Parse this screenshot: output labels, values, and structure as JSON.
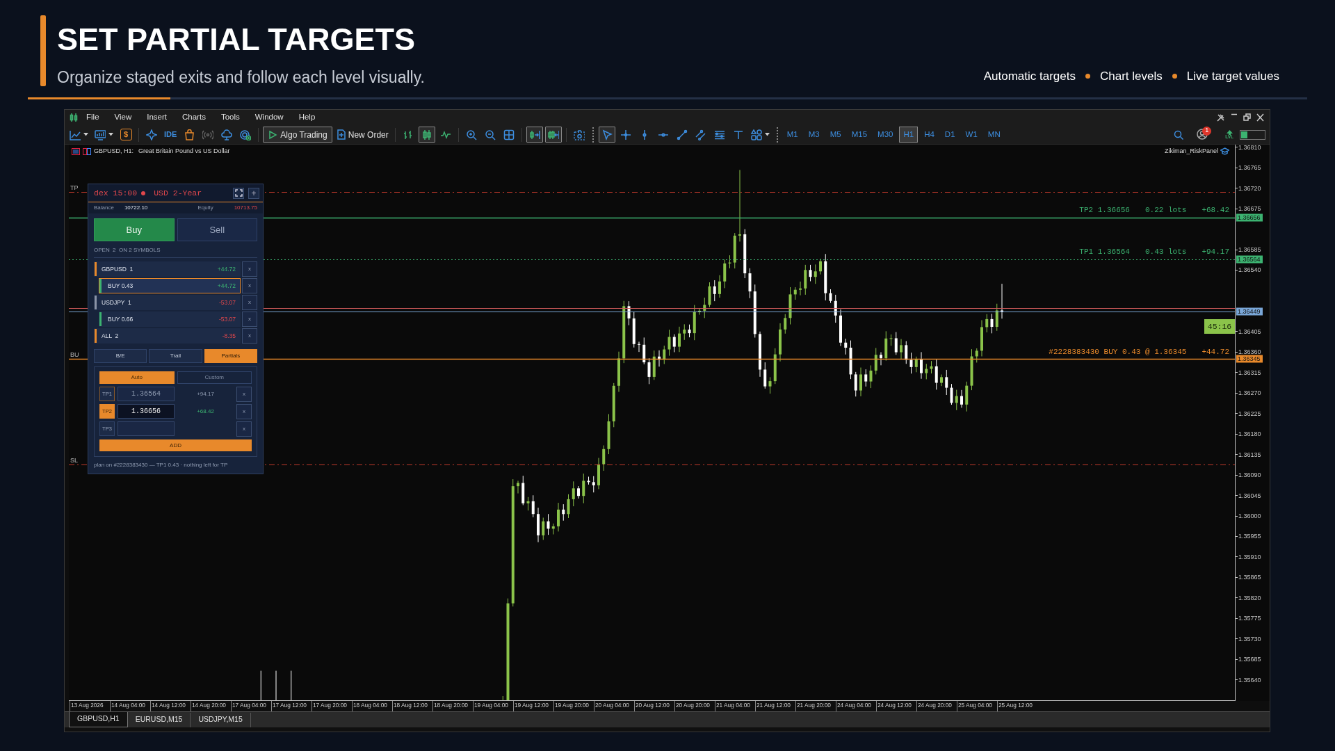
{
  "header": {
    "title": "SET PARTIAL TARGETS",
    "subtitle": "Organize staged exits and follow each level visually.",
    "features": [
      "Automatic targets",
      "Chart levels",
      "Live target values"
    ]
  },
  "menu": [
    "File",
    "View",
    "Insert",
    "Charts",
    "Tools",
    "Window",
    "Help"
  ],
  "toolbar": [
    {
      "kind": "line_chart",
      "pressed": false
    },
    {
      "kind": "monitor",
      "pressed": false
    },
    {
      "kind": "dollar",
      "label": "$",
      "pressed": false
    },
    {
      "kind": "sparkle",
      "pressed": false
    },
    {
      "kind": "ide",
      "label": "IDE",
      "pressed": false
    },
    {
      "kind": "bag",
      "pressed": false
    },
    {
      "kind": "signal",
      "pressed": false
    },
    {
      "kind": "cloud",
      "pressed": false
    },
    {
      "kind": "globe",
      "pressed": false
    },
    {
      "kind": "algo",
      "label": "Algo Trading",
      "pressed": true
    },
    {
      "kind": "order",
      "label": "New Order",
      "pressed": false
    },
    {
      "kind": "bars",
      "pressed": false
    },
    {
      "kind": "candles",
      "pressed": true
    },
    {
      "kind": "wave",
      "pressed": false
    },
    {
      "kind": "zoom_in",
      "pressed": false
    },
    {
      "kind": "zoom_out",
      "pressed": false
    },
    {
      "kind": "grid",
      "pressed": false
    },
    {
      "kind": "autoscroll",
      "pressed": true
    },
    {
      "kind": "shift",
      "pressed": true
    },
    {
      "kind": "camera",
      "pressed": false
    },
    {
      "kind": "cursor",
      "pressed": true
    },
    {
      "kind": "crosshair",
      "pressed": false
    },
    {
      "kind": "vline",
      "pressed": false
    },
    {
      "kind": "hline",
      "pressed": false
    },
    {
      "kind": "trend",
      "pressed": false
    },
    {
      "kind": "channel",
      "pressed": false
    },
    {
      "kind": "fibo",
      "pressed": false
    },
    {
      "kind": "text_tool",
      "pressed": false
    },
    {
      "kind": "shapes",
      "pressed": false
    }
  ],
  "timeframes": [
    {
      "label": "M1",
      "selected": false
    },
    {
      "label": "M3",
      "selected": false
    },
    {
      "label": "M5",
      "selected": false
    },
    {
      "label": "M15",
      "selected": false
    },
    {
      "label": "M30",
      "selected": false
    },
    {
      "label": "H1",
      "selected": true
    },
    {
      "label": "H4",
      "selected": false
    },
    {
      "label": "D1",
      "selected": false
    },
    {
      "label": "W1",
      "selected": false
    },
    {
      "label": "MN",
      "selected": false
    }
  ],
  "status": {
    "notifications": "1",
    "lvl": "LVL"
  },
  "chart": {
    "symbol": "GBPUSD, H1:",
    "description": "Great Britain Pound vs US Dollar",
    "indicator": "Zikiman_RiskPanel",
    "price_ticks": [
      "1.36810",
      "1.36765",
      "1.36720",
      "1.36675",
      "1.36585",
      "1.36540",
      "1.36405",
      "1.36360",
      "1.36315",
      "1.36270",
      "1.36225",
      "1.36180",
      "1.36135",
      "1.36090",
      "1.36045",
      "1.36000",
      "1.35955",
      "1.35910",
      "1.35865",
      "1.35820",
      "1.35775",
      "1.35730",
      "1.35685",
      "1.35640"
    ],
    "levels": [
      {
        "kind": "tp_zone",
        "edge_label": "TP"
      },
      {
        "kind": "tp2",
        "texts": [
          "TP2 1.36656",
          "0.22 lots",
          "+68.42"
        ],
        "tag": "1.36656"
      },
      {
        "kind": "tp1",
        "texts": [
          "TP1 1.36564",
          "0.43 lots",
          "+94.17"
        ],
        "tag": "1.36564"
      },
      {
        "kind": "ask"
      },
      {
        "kind": "bid",
        "tag": "1.36449"
      },
      {
        "kind": "entry",
        "edge_label": "BU",
        "texts": [
          "#2228383430 BUY 0.43 @ 1.36345",
          "+44.72"
        ],
        "tag": "1.36345"
      },
      {
        "kind": "sl_zone",
        "edge_label": "SL"
      }
    ],
    "timer": "45:16",
    "time_labels": [
      "13 Aug 2026",
      "14 Aug 04:00",
      "14 Aug 12:00",
      "14 Aug 20:00",
      "17 Aug 04:00",
      "17 Aug 12:00",
      "17 Aug 20:00",
      "18 Aug 04:00",
      "18 Aug 12:00",
      "18 Aug 20:00",
      "19 Aug 04:00",
      "19 Aug 12:00",
      "19 Aug 20:00",
      "20 Aug 04:00",
      "20 Aug 12:00",
      "20 Aug 20:00",
      "21 Aug 04:00",
      "21 Aug 12:00",
      "21 Aug 20:00",
      "24 Aug 04:00",
      "24 Aug 12:00",
      "24 Aug 20:00",
      "25 Aug 04:00",
      "25 Aug 12:00"
    ]
  },
  "tabs": [
    {
      "label": "GBPUSD,H1",
      "selected": true
    },
    {
      "label": "EURUSD,M15",
      "selected": false
    },
    {
      "label": "USDJPY,M15",
      "selected": false
    }
  ],
  "panel": {
    "ticker": "dex 15:00",
    "event": "USD 2-Year",
    "plus": "+",
    "balance_label": "Balance",
    "balance": "10722.10",
    "equity_label": "Equity",
    "equity": "10713.75",
    "sides": [
      {
        "label": "Buy",
        "selected": true
      },
      {
        "label": "Sell",
        "selected": false
      }
    ],
    "summary": "OPEN  2  ON 2 SYMBOLS",
    "positions": [
      {
        "kind": "symbol",
        "name": "GBPUSD  1",
        "pnl": "+44.72",
        "positive": true,
        "color": "#e8892b",
        "selected": false,
        "remove": "x"
      },
      {
        "kind": "order",
        "name": "BUY 0.43",
        "pnl": "+44.72",
        "positive": true,
        "color": "#3cb371",
        "selected": true,
        "remove": "x"
      },
      {
        "kind": "symbol",
        "name": "USDJPY  1",
        "pnl": "-53.07",
        "positive": false,
        "color": "#8a93a6",
        "selected": false,
        "remove": "x"
      },
      {
        "kind": "order",
        "name": "BUY 0.66",
        "pnl": "-53.07",
        "positive": false,
        "color": "#3cb371",
        "selected": false,
        "remove": "x"
      },
      {
        "kind": "total",
        "name": "ALL  2",
        "pnl": "-8.35",
        "positive": false,
        "color": "#e8892b",
        "selected": false,
        "remove": "x"
      }
    ],
    "tools": [
      {
        "label": "B/E",
        "selected": false
      },
      {
        "label": "Trail",
        "selected": false
      },
      {
        "label": "Partials",
        "selected": true
      }
    ],
    "modes": [
      {
        "label": "Auto",
        "selected": true
      },
      {
        "label": "Custom",
        "selected": false
      }
    ],
    "targets": [
      {
        "label": "TP1",
        "value": "1.36564",
        "pnl": "+94.17",
        "set": true,
        "selected": false,
        "remove": "x"
      },
      {
        "label": "TP2",
        "value": "1.36656",
        "pnl": "+68.42",
        "set": true,
        "selected": true,
        "remove": "x"
      },
      {
        "label": "TP3",
        "set": false,
        "selected": false,
        "remove": "x"
      }
    ],
    "add_label": "ADD",
    "note": "plan on #2228383430 — TP1 0.43 · nothing left for TP"
  }
}
